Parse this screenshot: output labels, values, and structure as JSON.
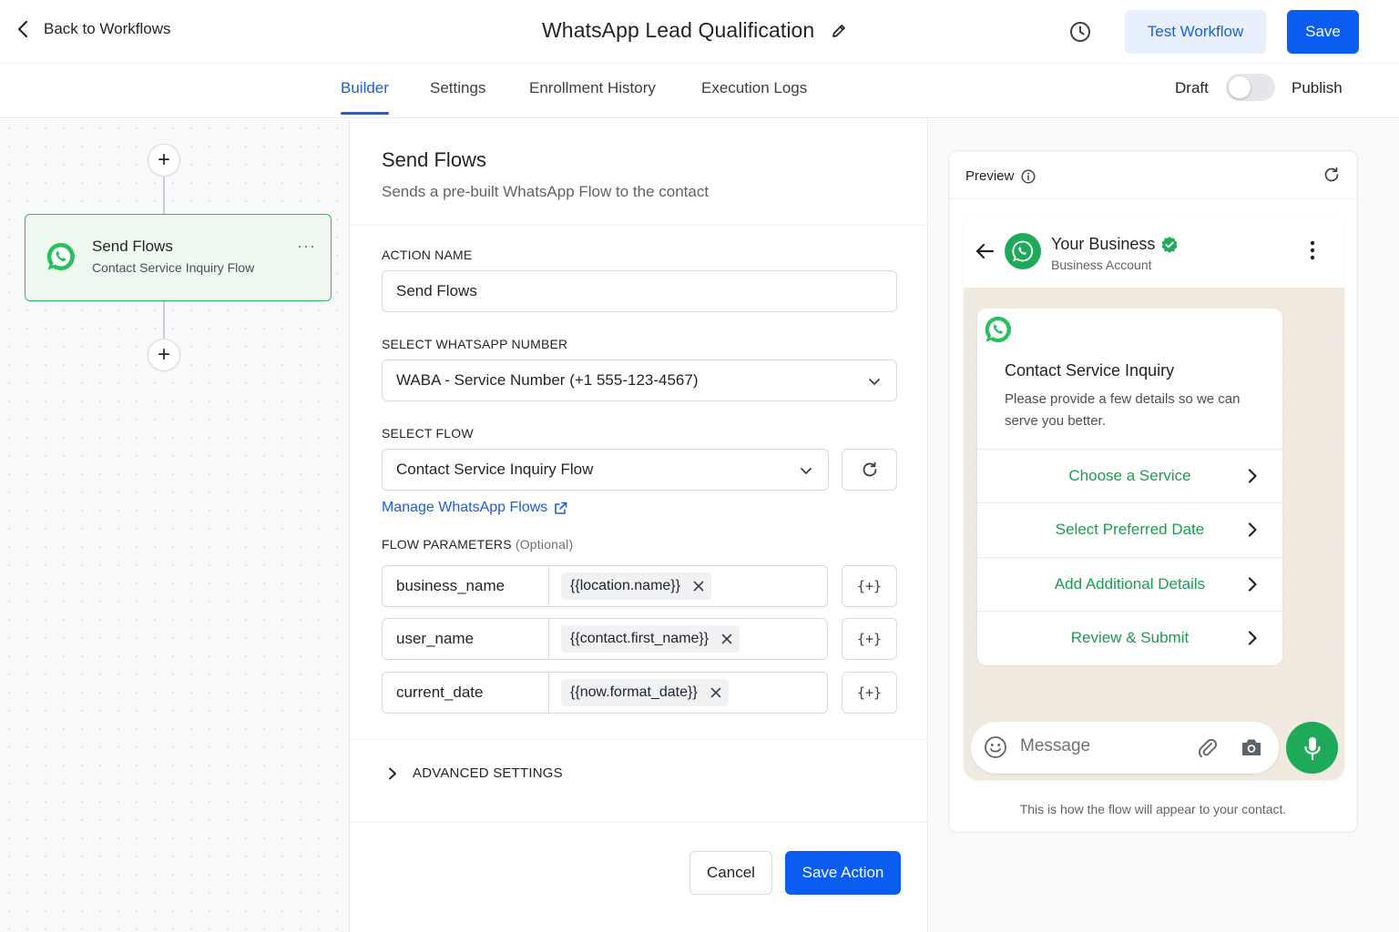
{
  "header": {
    "back_label": "Back to Workflows",
    "title": "WhatsApp Lead Qualification",
    "test_label": "Test Workflow",
    "save_label": "Save"
  },
  "tabs": [
    {
      "label": "Builder",
      "active": true
    },
    {
      "label": "Settings",
      "active": false
    },
    {
      "label": "Enrollment History",
      "active": false
    },
    {
      "label": "Execution Logs",
      "active": false
    }
  ],
  "status": {
    "draft_label": "Draft",
    "publish_label": "Publish",
    "published": false
  },
  "canvas": {
    "node": {
      "title": "Send Flows",
      "subtitle": "Contact Service Inquiry Flow",
      "menu": "···"
    },
    "add_symbol": "+"
  },
  "form": {
    "title": "Send Flows",
    "description": "Sends a pre-built WhatsApp Flow to the contact",
    "action_name_label": "ACTION NAME",
    "action_name_value": "Send Flows",
    "number_label": "SELECT WHATSAPP NUMBER",
    "number_value": "WABA - Service Number (+1 555-123-4567)",
    "flow_label": "SELECT FLOW",
    "flow_value": "Contact Service Inquiry Flow",
    "manage_link": "Manage WhatsApp Flows",
    "params_label": "FLOW PARAMETERS",
    "params_optional": "(Optional)",
    "params": [
      {
        "key": "business_name",
        "value": "{{location.name}}"
      },
      {
        "key": "user_name",
        "value": "{{contact.first_name}}"
      },
      {
        "key": "current_date",
        "value": "{{now.format_date}}"
      }
    ],
    "var_button": "{+}",
    "advanced_label": "ADVANCED SETTINGS",
    "cancel_label": "Cancel",
    "save_action_label": "Save Action"
  },
  "preview": {
    "label": "Preview",
    "business_name": "Your Business",
    "business_sub": "Business Account",
    "message_title": "Contact Service Inquiry",
    "message_body": "Please provide a few details so we can serve you better.",
    "actions": [
      "Choose a Service",
      "Select Preferred Date",
      "Add Additional Details",
      "Review & Submit"
    ],
    "input_placeholder": "Message",
    "note": "This is how the flow will appear to your contact."
  },
  "colors": {
    "primary": "#0b5cf0",
    "whatsapp_green": "#1faa59",
    "node_border": "#33b864"
  }
}
